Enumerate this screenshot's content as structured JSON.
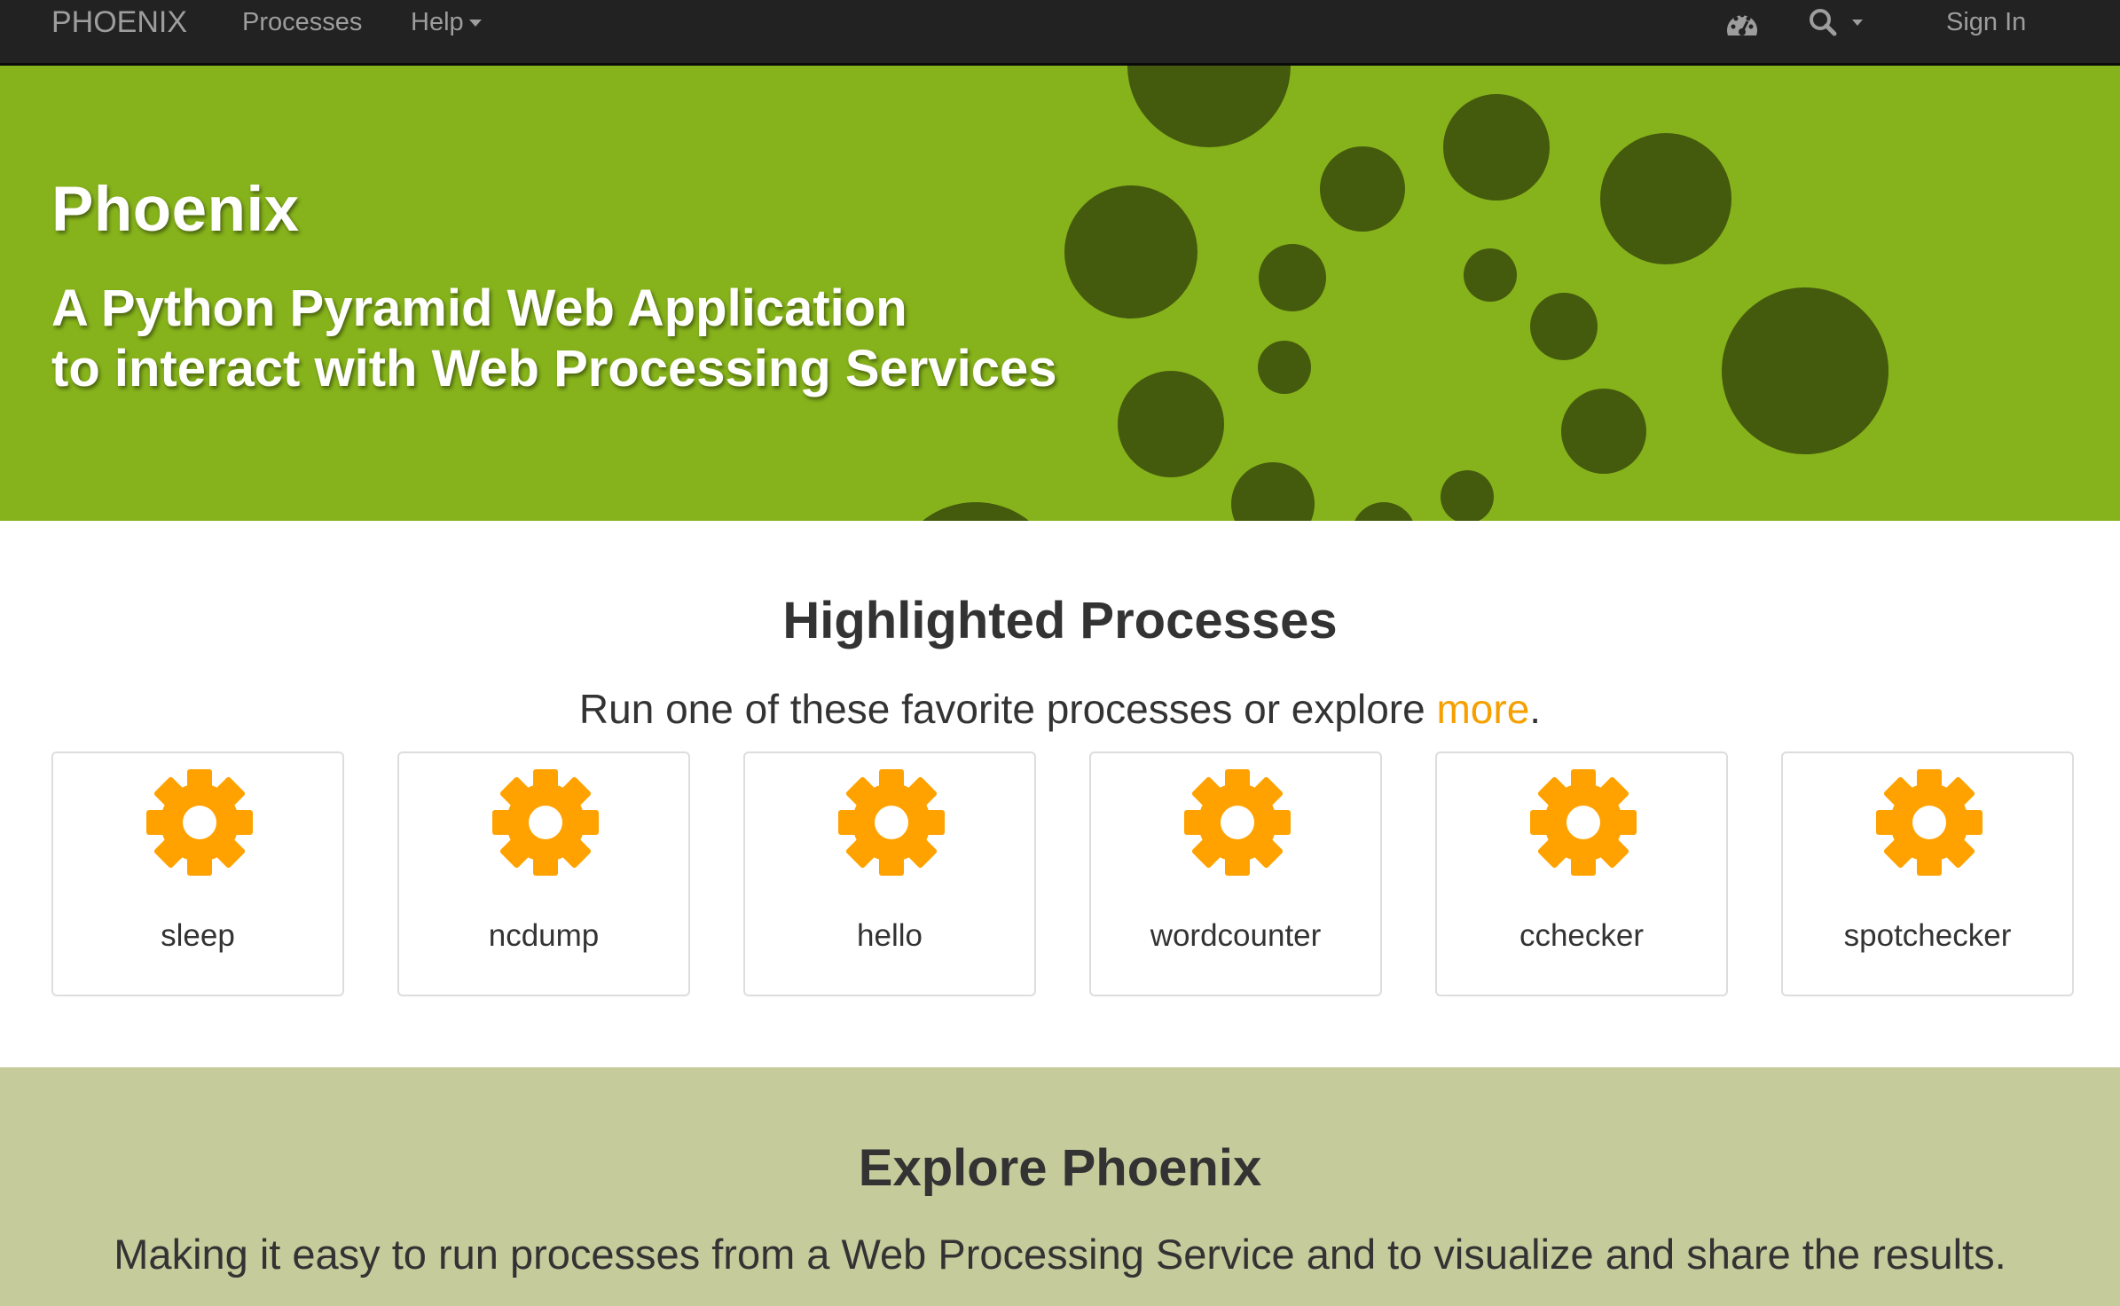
{
  "navbar": {
    "brand": "PHOENIX",
    "processes": "Processes",
    "help": "Help",
    "sign_in": "Sign In",
    "icons": [
      "dashboard-icon",
      "search-icon",
      "caret-down-icon"
    ]
  },
  "hero": {
    "title": "Phoenix",
    "subtitle_line1": "A Python Pyramid Web Application",
    "subtitle_line2": "to interact with Web Processing Services",
    "background_color": "#86b31b",
    "dot_color": "#445a0d"
  },
  "highlighted": {
    "title": "Highlighted Processes",
    "lead_before": "Run one of these favorite processes or explore ",
    "lead_link": "more",
    "lead_after": ".",
    "link_color": "#f5a000",
    "gear_color": "#ffa200",
    "processes": [
      "sleep",
      "ncdump",
      "hello",
      "wordcounter",
      "cchecker",
      "spotchecker"
    ]
  },
  "explore": {
    "title": "Explore Phoenix",
    "lead": "Making it easy to run processes from a Web Processing Service and to visualize and share the results.",
    "background_color": "#c5cb9b"
  }
}
